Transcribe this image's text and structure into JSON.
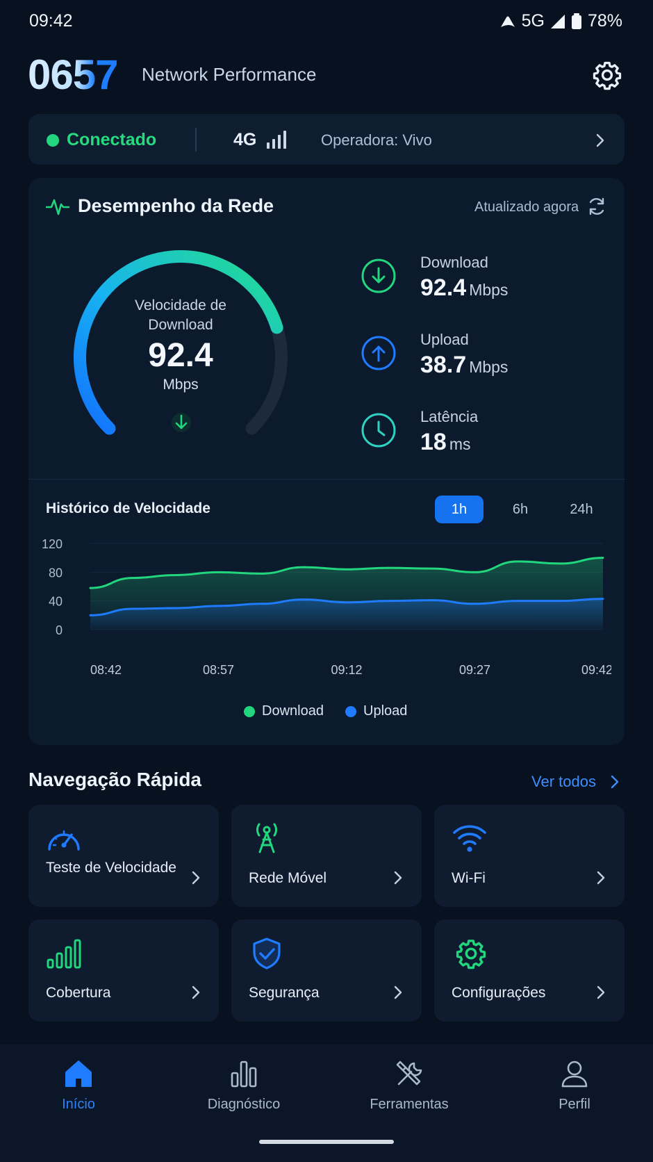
{
  "status_bar": {
    "time": "09:42",
    "network": "5G",
    "battery": "78%"
  },
  "header": {
    "logo": "0657",
    "title": "Network Performance"
  },
  "connection": {
    "status": "Conectado",
    "network_type": "4G",
    "operator": "Operadora: Vivo"
  },
  "performance": {
    "title": "Desempenho da Rede",
    "updated": "Atualizado agora",
    "gauge": {
      "label": "Velocidade de Download",
      "value": "92.4",
      "unit": "Mbps",
      "fill_fraction": 0.77
    },
    "metrics": [
      {
        "label": "Download",
        "value": "92.4",
        "unit": "Mbps",
        "icon": "download-arrow-icon"
      },
      {
        "label": "Upload",
        "value": "38.7",
        "unit": "Mbps",
        "icon": "upload-arrow-icon"
      },
      {
        "label": "Latência",
        "value": "18",
        "unit": "ms",
        "icon": "clock-icon"
      }
    ]
  },
  "history": {
    "title": "Histórico de Velocidade",
    "tabs": [
      "1h",
      "6h",
      "24h"
    ],
    "active_tab": "1h",
    "legend": {
      "download": "Download",
      "upload": "Upload"
    }
  },
  "chart_data": {
    "type": "area",
    "x": [
      "08:42",
      "08:47",
      "08:52",
      "08:57",
      "09:02",
      "09:07",
      "09:12",
      "09:17",
      "09:22",
      "09:27",
      "09:32",
      "09:37",
      "09:42"
    ],
    "x_ticks": [
      "08:42",
      "08:57",
      "09:12",
      "09:27",
      "09:42"
    ],
    "y_ticks": [
      0,
      40,
      80,
      120
    ],
    "ylim": [
      0,
      120
    ],
    "series": [
      {
        "name": "Download",
        "color": "#22d67e",
        "values": [
          58,
          72,
          76,
          80,
          78,
          87,
          84,
          86,
          85,
          80,
          95,
          92,
          100
        ]
      },
      {
        "name": "Upload",
        "color": "#1f7bff",
        "values": [
          20,
          29,
          30,
          33,
          36,
          42,
          38,
          40,
          41,
          36,
          40,
          40,
          43
        ]
      }
    ],
    "grid": true,
    "legend_position": "bottom-center"
  },
  "quick_nav": {
    "title": "Navegação Rápida",
    "link": "Ver todos",
    "tiles": [
      {
        "label": "Teste de Velocidade",
        "icon": "speedometer-icon"
      },
      {
        "label": "Rede Móvel",
        "icon": "cell-tower-icon"
      },
      {
        "label": "Wi-Fi",
        "icon": "wifi-icon"
      },
      {
        "label": "Cobertura",
        "icon": "signal-bars-icon"
      },
      {
        "label": "Segurança",
        "icon": "shield-check-icon"
      },
      {
        "label": "Configurações",
        "icon": "gear-icon"
      }
    ]
  },
  "bottom_nav": [
    {
      "label": "Início",
      "icon": "home-icon",
      "active": true
    },
    {
      "label": "Diagnóstico",
      "icon": "bar-chart-icon",
      "active": false
    },
    {
      "label": "Ferramentas",
      "icon": "tools-icon",
      "active": false
    },
    {
      "label": "Perfil",
      "icon": "user-icon",
      "active": false
    }
  ],
  "colors": {
    "accent": "#1673f0",
    "success": "#22d67e",
    "background": "#07111f",
    "card": "#0c1a2d"
  }
}
